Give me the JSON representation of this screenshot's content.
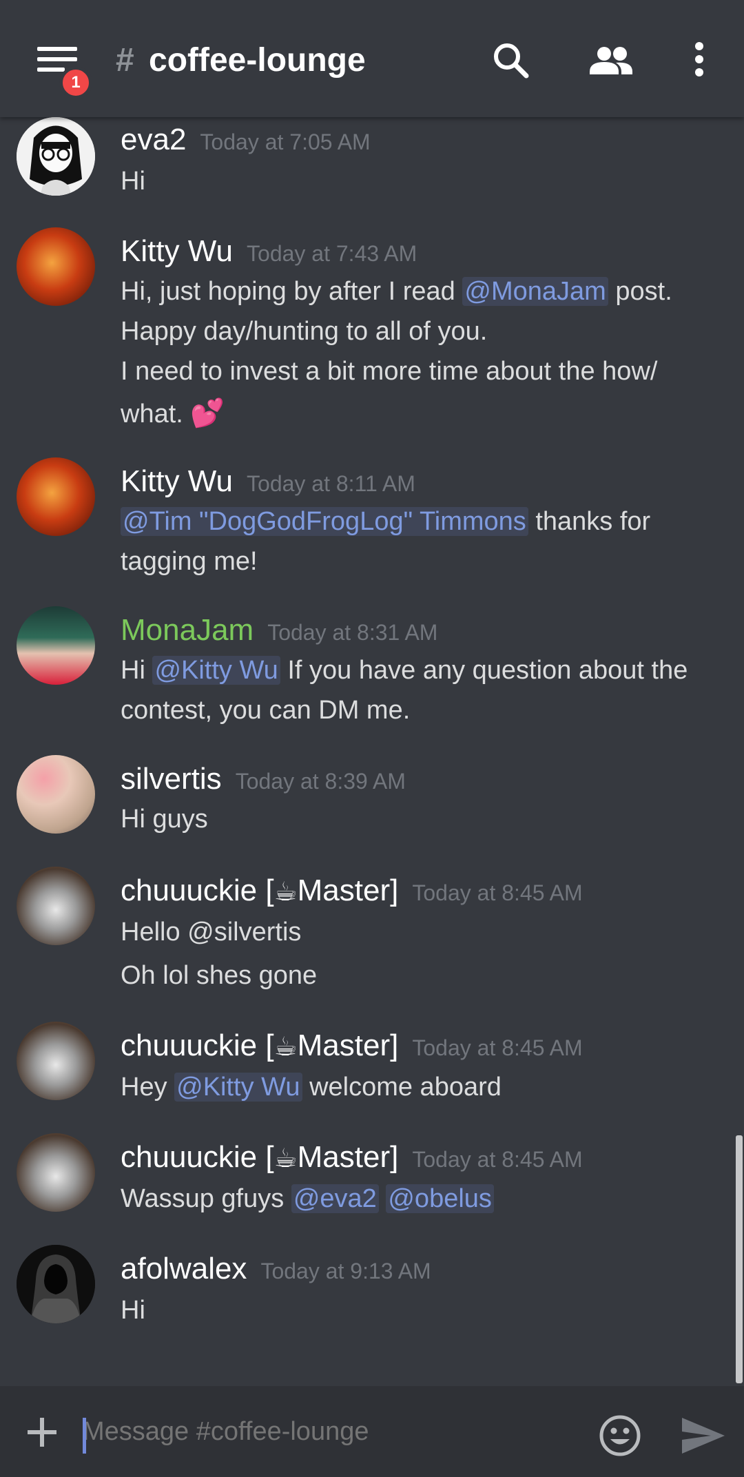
{
  "header": {
    "notification_count": "1",
    "hash": "#",
    "channel_name": "coffee-lounge"
  },
  "messages": [
    {
      "author": "eva2",
      "time": "Today at 7:05 AM",
      "lines": [
        "Hi"
      ]
    },
    {
      "author": "Kitty Wu",
      "time": "Today at 7:43 AM",
      "lines": [
        "Hi, just hoping by after I read",
        "@MonaJam",
        "post.",
        "Happy day/hunting to all of you.",
        "I need to invest a bit more time about the how/",
        "what.",
        "💕"
      ]
    },
    {
      "author": "Kitty Wu",
      "time": "Today at 8:11 AM",
      "lines": [
        "@Tim \"DogGodFrogLog\" Timmons",
        "thanks for",
        "tagging me!"
      ]
    },
    {
      "author": "MonaJam",
      "time": "Today at 8:31 AM",
      "lines": [
        "Hi",
        "@Kitty Wu",
        "If you have any question about the",
        "contest, you can DM me."
      ]
    },
    {
      "author": "silvertis",
      "time": "Today at 8:39 AM",
      "lines": [
        "Hi guys"
      ]
    },
    {
      "author_prefix": "chuuuckie [",
      "author_emoji": "☕",
      "author_suffix": "Master]",
      "time": "Today at 8:45 AM",
      "lines": [
        "Hello @silvertis",
        "Oh lol shes gone"
      ]
    },
    {
      "author_prefix": "chuuuckie [",
      "author_emoji": "☕",
      "author_suffix": "Master]",
      "time": "Today at 8:45 AM",
      "lines": [
        "Hey",
        "@Kitty Wu",
        "welcome aboard"
      ]
    },
    {
      "author_prefix": "chuuuckie [",
      "author_emoji": "☕",
      "author_suffix": "Master]",
      "time": "Today at 8:45 AM",
      "lines": [
        "Wassup  gfuys",
        "@eva2",
        "@obelus"
      ]
    },
    {
      "author": "afolwalex",
      "time": "Today at 9:13 AM",
      "lines": [
        "Hi"
      ]
    }
  ],
  "composer": {
    "placeholder": "Message #coffee-lounge"
  },
  "icons": [
    "menu-icon",
    "search-icon",
    "members-icon",
    "more-vertical-icon",
    "plus-icon",
    "emoji-icon",
    "send-icon"
  ],
  "colors": {
    "background": "#36393f",
    "mention": "#7f9be0",
    "username_green": "#7cc95b",
    "badge": "#f04747"
  }
}
